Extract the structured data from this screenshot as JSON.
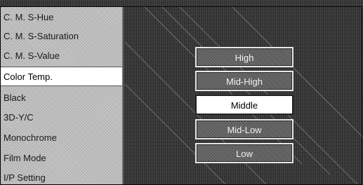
{
  "menu": {
    "items": [
      {
        "label": "C. M. S-Hue"
      },
      {
        "label": "C. M. S-Saturation"
      },
      {
        "label": "C. M. S-Value"
      },
      {
        "label": "Color Temp."
      },
      {
        "label": "Black"
      },
      {
        "label": "3D-Y/C"
      },
      {
        "label": "Monochrome"
      },
      {
        "label": "Film Mode"
      },
      {
        "label": "I/P Setting"
      }
    ],
    "selected": "Color Temp."
  },
  "options": {
    "items": [
      {
        "label": "High"
      },
      {
        "label": "Mid-High"
      },
      {
        "label": "Middle"
      },
      {
        "label": "Mid-Low"
      },
      {
        "label": "Low"
      }
    ],
    "selected": "Middle"
  }
}
